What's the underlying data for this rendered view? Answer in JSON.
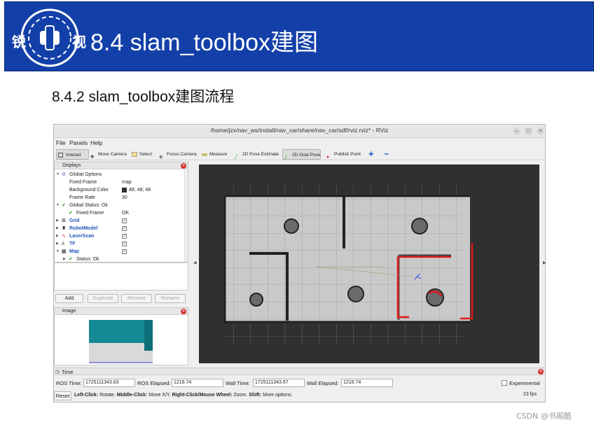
{
  "banner": {
    "title": "8.4 slam_toolbox建图",
    "logo_chars": [
      "锐",
      "视"
    ]
  },
  "subtitle": "8.4.2 slam_toolbox建图流程",
  "window": {
    "title": "/home/jzx/nav_ws/install/nav_car/share/nav_car/sdf/rviz.rviz* - RViz",
    "controls": [
      "–",
      "□",
      "×"
    ],
    "menus": [
      "File",
      "Panels",
      "Help"
    ],
    "tools": [
      {
        "label": "Interact",
        "icon": "cursor-icon",
        "active": true
      },
      {
        "label": "Move Camera",
        "icon": "move-camera-icon"
      },
      {
        "label": "Select",
        "icon": "select-icon"
      },
      {
        "label": "Focus Camera",
        "icon": "focus-camera-icon"
      },
      {
        "label": "Measure",
        "icon": "measure-icon"
      },
      {
        "label": "2D Pose Estimate",
        "icon": "pose-estimate-icon"
      },
      {
        "label": "2D Goal Pose",
        "icon": "goal-pose-icon",
        "active": true
      },
      {
        "label": "Publish Point",
        "icon": "publish-point-icon"
      }
    ]
  },
  "displays": {
    "title": "Displays",
    "rows": [
      {
        "label": "Global Options"
      },
      {
        "label": "Fixed Frame",
        "value": "map"
      },
      {
        "label": "Background Color",
        "value": "48; 48; 48"
      },
      {
        "label": "Frame Rate",
        "value": "30"
      },
      {
        "label": "Global Status: Ok"
      },
      {
        "label": "Fixed Frame",
        "value": "OK"
      },
      {
        "label": "Grid"
      },
      {
        "label": "RobotModel"
      },
      {
        "label": "LaserScan"
      },
      {
        "label": "TF"
      },
      {
        "label": "Map"
      },
      {
        "label": "Status: Ok"
      }
    ],
    "buttons": [
      "Add",
      "Duplicate",
      "Remove",
      "Rename"
    ]
  },
  "image_panel": {
    "title": "Image"
  },
  "time": {
    "title": "Time",
    "ros_time_label": "ROS Time:",
    "ros_time": "1725111343.63",
    "ros_elapsed_label": "ROS Elapsed:",
    "ros_elapsed": "1216.74",
    "wall_time_label": "Wall Time:",
    "wall_time": "1725111343.67",
    "wall_elapsed_label": "Wall Elapsed:",
    "wall_elapsed": "1216.74",
    "experimental": "Experimental",
    "reset": "Reset",
    "hint_left_b": "Left-Click:",
    "hint_left": "Rotate.",
    "hint_mid_b": "Middle-Click:",
    "hint_mid": "Move X/Y.",
    "hint_right_b": "Right-Click/Mouse Wheel:",
    "hint_right": "Zoom.",
    "hint_shift_b": "Shift:",
    "hint_shift": "More options.",
    "fps": "23 fps"
  },
  "watermark": "CSDN @书阁酷",
  "colors": {
    "banner": "#1340a8",
    "viewport_bg": "#303030",
    "map_free": "#c9c9c9",
    "laser": "#e01818"
  }
}
